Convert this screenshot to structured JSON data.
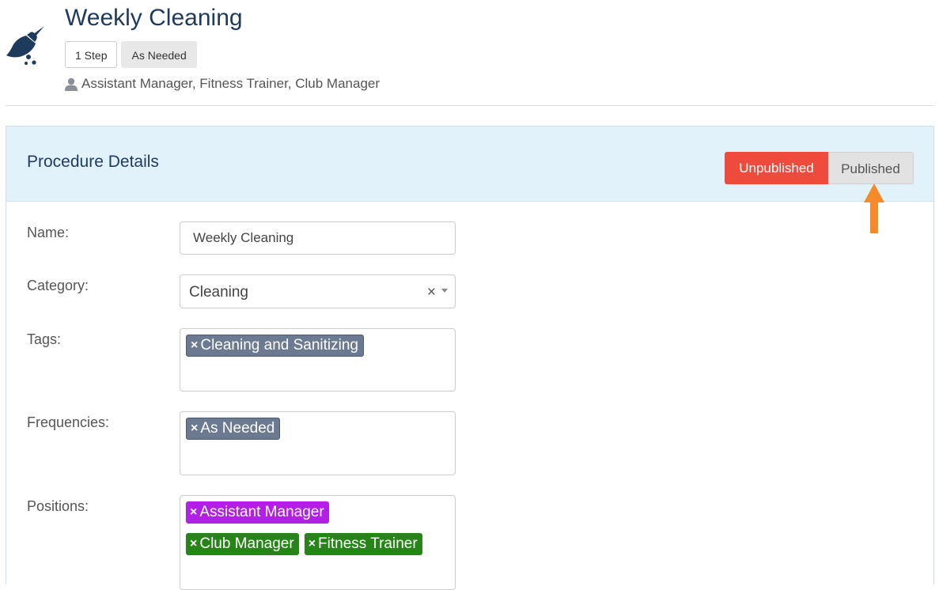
{
  "header": {
    "title": "Weekly Cleaning",
    "badges": {
      "steps": "1 Step",
      "frequency": "As Needed"
    },
    "positions": "Assistant Manager, Fitness Trainer, Club Manager"
  },
  "panel": {
    "title": "Procedure Details",
    "toggle": {
      "unpublished": "Unpublished",
      "published": "Published"
    }
  },
  "form": {
    "name": {
      "label": "Name:",
      "value": "Weekly Cleaning"
    },
    "category": {
      "label": "Category:",
      "value": "Cleaning",
      "clear": "×"
    },
    "tags": {
      "label": "Tags:",
      "chips": [
        "Cleaning and Sanitizing"
      ]
    },
    "frequencies": {
      "label": "Frequencies:",
      "chips": [
        "As Needed"
      ]
    },
    "positions": {
      "label": "Positions:",
      "chips": [
        "Assistant Manager",
        "Club Manager",
        "Fitness Trainer"
      ]
    }
  },
  "chip_remove": "×",
  "colors": {
    "title": "#1e3a5c",
    "panel_head": "#e2f2fa",
    "unpublished": "#ef4b3c",
    "published": "#e2e2e2",
    "arrow": "#f58a2a",
    "chip_gray": "#6b7a90",
    "chip_purple": "#b21fe6",
    "chip_green": "#278418"
  }
}
